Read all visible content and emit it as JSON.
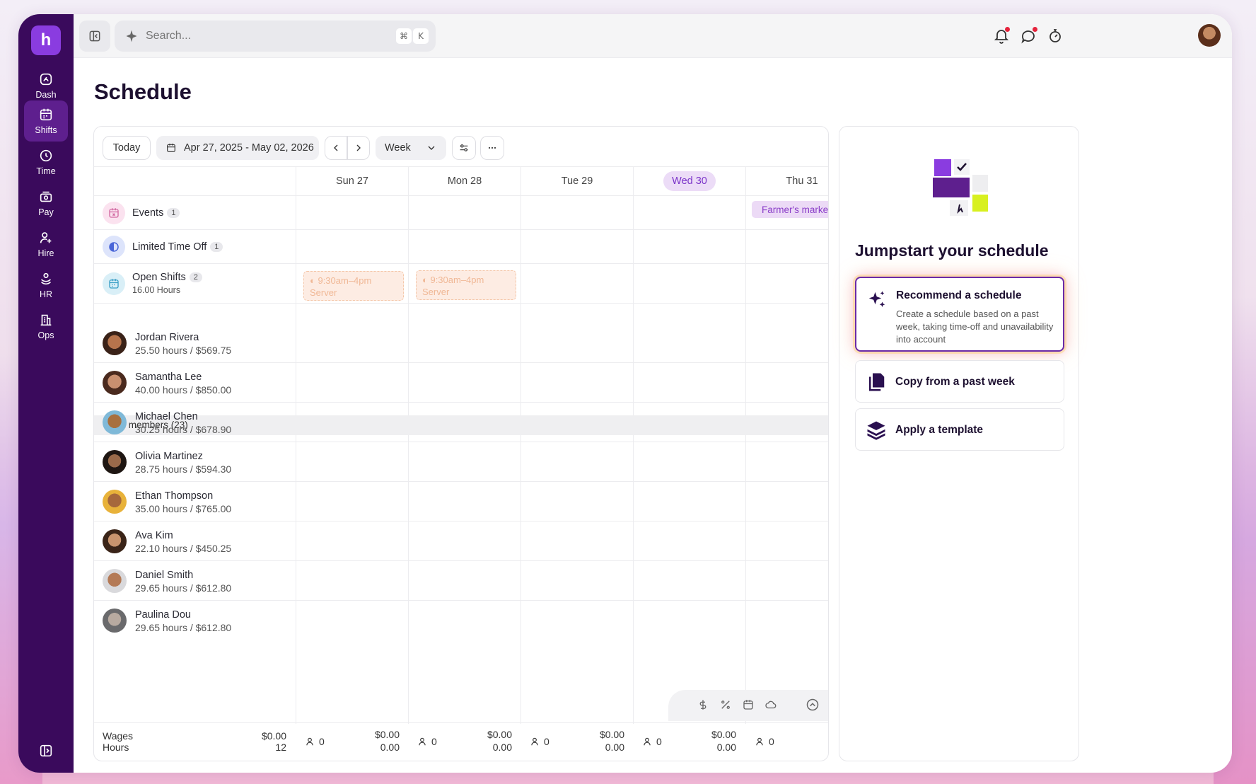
{
  "colors": {
    "brand": "#3a0a5c",
    "accent": "#8a3ce0",
    "today_chip": "#ecdcf7",
    "open_shift": "#fdece3"
  },
  "app": {
    "logo_letter": "h"
  },
  "sidebar": {
    "items": [
      {
        "label": "Dash",
        "icon": "dashboard-icon"
      },
      {
        "label": "Shifts",
        "icon": "calendar-icon",
        "active": true
      },
      {
        "label": "Time",
        "icon": "clock-icon"
      },
      {
        "label": "Pay",
        "icon": "money-icon"
      },
      {
        "label": "Hire",
        "icon": "user-plus-icon"
      },
      {
        "label": "HR",
        "icon": "hr-icon"
      },
      {
        "label": "Ops",
        "icon": "building-icon"
      }
    ]
  },
  "topbar": {
    "search_placeholder": "Search...",
    "kbd_cmd": "⌘",
    "kbd_key": "K"
  },
  "page": {
    "title": "Schedule"
  },
  "toolbar": {
    "today": "Today",
    "date_range": "Apr 27, 2025 - May 02, 2026",
    "view": "Week"
  },
  "days": [
    {
      "label": "Sun 27"
    },
    {
      "label": "Mon 28"
    },
    {
      "label": "Tue 29"
    },
    {
      "label": "Wed 30",
      "today": true
    },
    {
      "label": "Thu 31"
    }
  ],
  "special_rows": {
    "events": {
      "label": "Events",
      "count": "1",
      "chip": "Farmer's market"
    },
    "time_off": {
      "label": "Limited Time Off",
      "count": "1"
    },
    "open_shifts": {
      "label": "Open Shifts",
      "count": "2",
      "hours": "16.00 Hours",
      "shifts": [
        {
          "time": "9:30am–4pm",
          "role": "Server"
        },
        {
          "time": "9:30am–4pm",
          "role": "Server"
        }
      ]
    }
  },
  "team": {
    "header": "Team members (23)",
    "members": [
      {
        "name": "Jordan Rivera",
        "hours": "25.50 hours / $569.75"
      },
      {
        "name": "Samantha Lee",
        "hours": "40.00 hours / $850.00"
      },
      {
        "name": "Michael Chen",
        "hours": "30.25 hours / $678.90"
      },
      {
        "name": "Olivia Martinez",
        "hours": "28.75 hours / $594.30"
      },
      {
        "name": "Ethan Thompson",
        "hours": "35.00 hours / $765.00"
      },
      {
        "name": "Ava Kim",
        "hours": "22.10 hours / $450.25"
      },
      {
        "name": "Daniel Smith",
        "hours": "29.65 hours / $612.80"
      },
      {
        "name": "Paulina Dou",
        "hours": "29.65 hours / $612.80"
      }
    ]
  },
  "footer": {
    "wages_label": "Wages",
    "hours_label": "Hours",
    "total_wages": "$0.00",
    "total_hours": "12",
    "days": [
      {
        "people": "0",
        "wages": "$0.00",
        "hours": "0.00"
      },
      {
        "people": "0",
        "wages": "$0.00",
        "hours": "0.00"
      },
      {
        "people": "0",
        "wages": "$0.00",
        "hours": "0.00"
      },
      {
        "people": "0",
        "wages": "$0.00",
        "hours": "0.00"
      },
      {
        "people": "0"
      }
    ]
  },
  "panel": {
    "title": "Jumpstart your schedule",
    "options": [
      {
        "title": "Recommend a schedule",
        "desc": "Create a schedule based on a past week, taking time-off and unavailability into account"
      },
      {
        "title": "Copy from a past week"
      },
      {
        "title": "Apply a template"
      }
    ]
  }
}
